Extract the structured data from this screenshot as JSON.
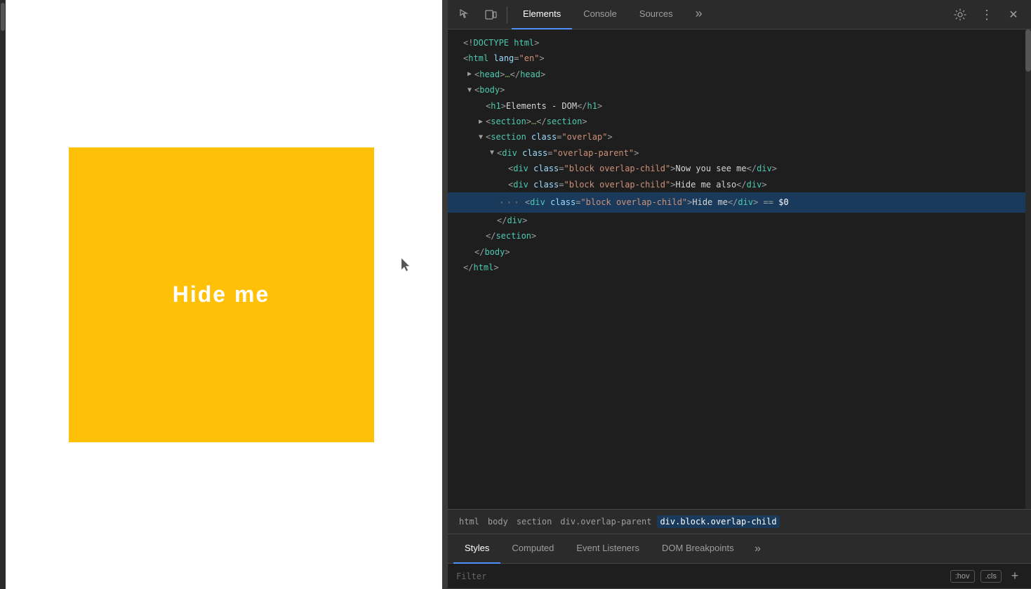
{
  "preview": {
    "box_text": "Hide me"
  },
  "devtools": {
    "toolbar": {
      "inspect_icon": "⬡",
      "device_icon": "▭",
      "tabs": [
        {
          "label": "Elements",
          "active": true
        },
        {
          "label": "Console",
          "active": false
        },
        {
          "label": "Sources",
          "active": false
        },
        {
          "label": "»",
          "active": false
        }
      ],
      "settings_label": "⚙",
      "more_label": "⋮",
      "close_label": "✕"
    },
    "dom_lines": [
      {
        "indent": 0,
        "arrow": "",
        "content_html": "<span class='tag-bracket'>&lt;!</span><span class='tag-name'>DOCTYPE html</span><span class='tag-bracket'>&gt;</span>"
      },
      {
        "indent": 0,
        "arrow": "",
        "content_html": "<span class='tag-bracket'>&lt;</span><span class='tag-name'>html</span> <span class='attr-name'>lang</span><span class='tag-bracket'>=</span><span class='attr-value'>\"en\"</span><span class='tag-bracket'>&gt;</span>"
      },
      {
        "indent": 1,
        "arrow": "▶",
        "content_html": "<span class='tag-bracket'>&lt;</span><span class='tag-name'>head</span><span class='tag-bracket'>&gt;</span><span class='tag-comment'>…</span><span class='tag-bracket'>&lt;/</span><span class='tag-name'>head</span><span class='tag-bracket'>&gt;</span>"
      },
      {
        "indent": 1,
        "arrow": "▼",
        "content_html": "<span class='tag-bracket'>&lt;</span><span class='tag-name'>body</span><span class='tag-bracket'>&gt;</span>"
      },
      {
        "indent": 2,
        "arrow": "",
        "content_html": "<span class='tag-bracket'>&lt;</span><span class='tag-name'>h1</span><span class='tag-bracket'>&gt;</span><span class='dom-text'>Elements - DOM</span><span class='tag-bracket'>&lt;/</span><span class='tag-name'>h1</span><span class='tag-bracket'>&gt;</span>"
      },
      {
        "indent": 2,
        "arrow": "▶",
        "content_html": "<span class='tag-bracket'>&lt;</span><span class='tag-name'>section</span><span class='tag-bracket'>&gt;</span><span class='tag-comment'>…</span><span class='tag-bracket'>&lt;/</span><span class='tag-name'>section</span><span class='tag-bracket'>&gt;</span>"
      },
      {
        "indent": 2,
        "arrow": "▼",
        "content_html": "<span class='tag-bracket'>&lt;</span><span class='tag-name'>section</span> <span class='attr-name'>class</span><span class='tag-bracket'>=</span><span class='attr-value'>\"overlap\"</span><span class='tag-bracket'>&gt;</span>"
      },
      {
        "indent": 3,
        "arrow": "▼",
        "content_html": "<span class='tag-bracket'>&lt;</span><span class='tag-name'>div</span> <span class='attr-name'>class</span><span class='tag-bracket'>=</span><span class='attr-value'>\"overlap-parent\"</span><span class='tag-bracket'>&gt;</span>"
      },
      {
        "indent": 4,
        "arrow": "",
        "content_html": "<span class='tag-bracket'>&lt;</span><span class='tag-name'>div</span> <span class='attr-name'>class</span><span class='tag-bracket'>=</span><span class='attr-value'>\"block overlap-child\"</span><span class='tag-bracket'>&gt;</span><span class='dom-text'>Now you see me</span><span class='tag-bracket'>&lt;/</span><span class='tag-name'>div</span><span class='tag-bracket'>&gt;</span>"
      },
      {
        "indent": 4,
        "arrow": "",
        "content_html": "<span class='tag-bracket'>&lt;</span><span class='tag-name'>div</span> <span class='attr-name'>class</span><span class='tag-bracket'>=</span><span class='attr-value'>\"block overlap-child\"</span><span class='tag-bracket'>&gt;</span><span class='dom-text'>Hide me also</span><span class='tag-bracket'>&lt;/</span><span class='tag-name'>div</span><span class='tag-bracket'>&gt;</span>"
      },
      {
        "indent": 4,
        "arrow": "",
        "content_html": "<span class='tag-bracket'>&lt;</span><span class='tag-name'>div</span> <span class='attr-name'>class</span><span class='tag-bracket'>=</span><span class='attr-value'>\"block overlap-child\"</span><span class='tag-bracket'>&gt;</span><span class='dom-text'>Hide me</span><span class='tag-bracket'>&lt;/</span><span class='tag-name'>div</span><span class='tag-bracket'>&gt;</span><span style='color:#9e9e9e'> == </span><span class='dollar-zero'>$0</span>",
        "selected": true,
        "has_dots": true
      },
      {
        "indent": 3,
        "arrow": "",
        "content_html": "<span class='tag-bracket'>&lt;/</span><span class='tag-name'>div</span><span class='tag-bracket'>&gt;</span>"
      },
      {
        "indent": 2,
        "arrow": "",
        "content_html": "<span class='tag-bracket'>&lt;/</span><span class='tag-name'>section</span><span class='tag-bracket'>&gt;</span>"
      },
      {
        "indent": 1,
        "arrow": "",
        "content_html": "<span class='tag-bracket'>&lt;/</span><span class='tag-name'>body</span><span class='tag-bracket'>&gt;</span>"
      },
      {
        "indent": 0,
        "arrow": "",
        "content_html": "<span class='tag-bracket'>&lt;/</span><span class='tag-name'>html</span><span class='tag-bracket'>&gt;</span>"
      }
    ],
    "breadcrumb": {
      "items": [
        {
          "label": "html",
          "active": false
        },
        {
          "label": "body",
          "active": false
        },
        {
          "label": "section",
          "active": false
        },
        {
          "label": "div.overlap-parent",
          "active": false
        },
        {
          "label": "div.block.overlap-child",
          "active": true
        }
      ]
    },
    "bottom_tabs": [
      {
        "label": "Styles",
        "active": true
      },
      {
        "label": "Computed",
        "active": false
      },
      {
        "label": "Event Listeners",
        "active": false
      },
      {
        "label": "DOM Breakpoints",
        "active": false
      }
    ],
    "filter": {
      "placeholder": "Filter",
      "hov_label": ":hov",
      "cls_label": ".cls",
      "add_label": "+"
    }
  }
}
